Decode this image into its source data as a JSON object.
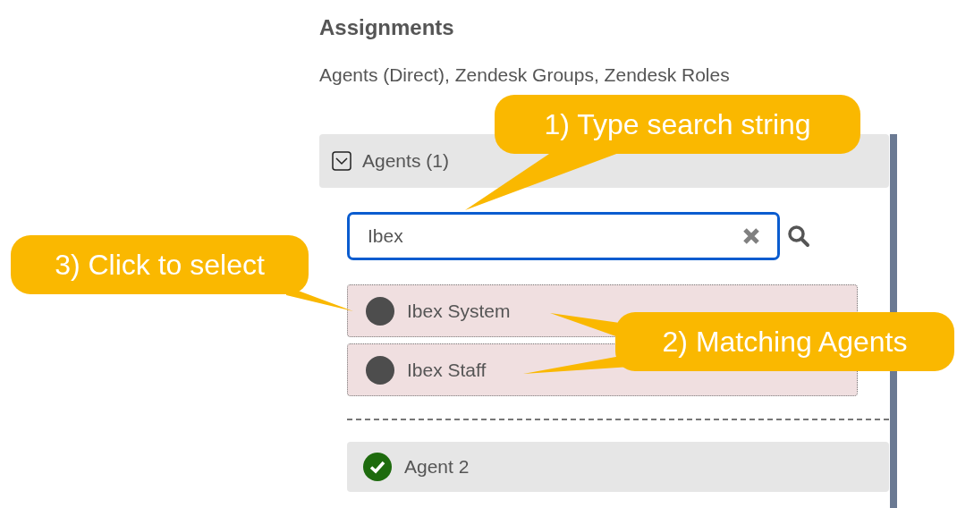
{
  "heading": "Assignments",
  "subtitle": "Agents (Direct), Zendesk Groups, Zendesk Roles",
  "section": {
    "label": "Agents (1)",
    "expanded": true
  },
  "search": {
    "value": "Ibex"
  },
  "results": [
    {
      "name": "Ibex System",
      "selected": false
    },
    {
      "name": "Ibex Staff",
      "selected": false
    }
  ],
  "assigned": [
    {
      "name": "Agent 2",
      "selected": true
    }
  ],
  "callouts": [
    {
      "text": "1) Type search string"
    },
    {
      "text": "2) Matching Agents"
    },
    {
      "text": "3) Click to select"
    }
  ]
}
